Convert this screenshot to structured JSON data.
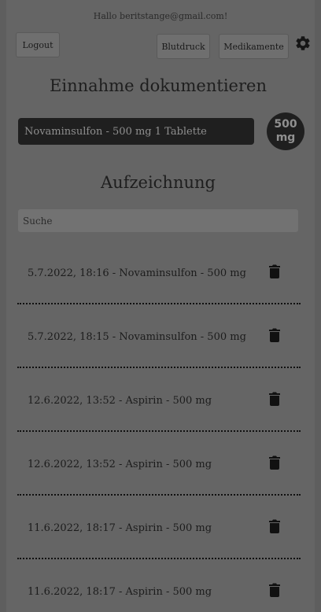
{
  "greeting": "Hallo beritstange@gmail.com!",
  "header": {
    "logout_label": "Logout",
    "blutdruck_label": "Blutdruck",
    "medikamente_label": "Medikamente",
    "settings_icon": "gear-icon"
  },
  "intake": {
    "title": "Einnahme dokumentieren",
    "selected_medication": "Novaminsulfon - 500 mg 1 Tablette",
    "dose_line1": "500",
    "dose_line2": "mg"
  },
  "records": {
    "title": "Aufzeichnung",
    "search_placeholder": "Suche",
    "delete_icon": "trash-icon",
    "items": [
      {
        "text": "5.7.2022, 18:16 - Novaminsulfon - 500 mg"
      },
      {
        "text": "5.7.2022, 18:15 - Novaminsulfon - 500 mg"
      },
      {
        "text": "12.6.2022, 13:52 - Aspirin - 500 mg"
      },
      {
        "text": "12.6.2022, 13:52 - Aspirin - 500 mg"
      },
      {
        "text": "11.6.2022, 18:17 - Aspirin - 500 mg"
      },
      {
        "text": "11.6.2022, 18:17 - Aspirin - 500 mg"
      }
    ]
  }
}
